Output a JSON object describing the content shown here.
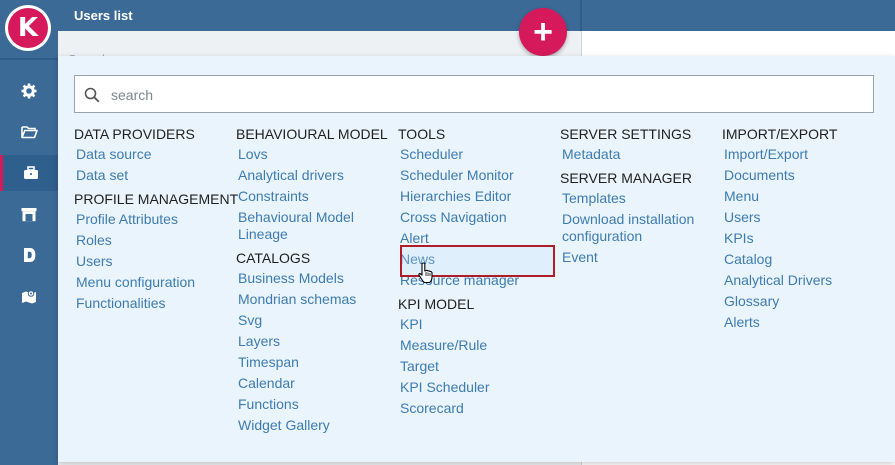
{
  "app": {
    "logo_letter": "K",
    "title": "Users list",
    "add_label": "+"
  },
  "search": {
    "placeholder": "search",
    "bg_placeholder": "Search"
  },
  "columns": [
    {
      "groups": [
        {
          "title": "DATA PROVIDERS",
          "items": [
            "Data source",
            "Data set"
          ]
        },
        {
          "title": "PROFILE MANAGEMENT",
          "items": [
            "Profile Attributes",
            "Roles",
            "Users",
            "Menu configuration",
            "Functionalities"
          ]
        }
      ]
    },
    {
      "groups": [
        {
          "title": "BEHAVIOURAL MODEL",
          "items": [
            "Lovs",
            "Analytical drivers",
            "Constraints",
            "Behavioural Model Lineage"
          ]
        },
        {
          "title": "CATALOGS",
          "items": [
            "Business Models",
            "Mondrian schemas",
            "Svg",
            "Layers",
            "Timespan",
            "Calendar",
            "Functions",
            "Widget Gallery"
          ]
        }
      ]
    },
    {
      "groups": [
        {
          "title": "TOOLS",
          "items": [
            "Scheduler",
            "Scheduler Monitor",
            "Hierarchies Editor",
            "Cross Navigation",
            "Alert",
            "News",
            "Resource manager"
          ]
        },
        {
          "title": "KPI MODEL",
          "items": [
            "KPI",
            "Measure/Rule",
            "Target",
            "KPI Scheduler",
            "Scorecard"
          ]
        }
      ]
    },
    {
      "groups": [
        {
          "title": "SERVER SETTINGS",
          "items": [
            "Metadata"
          ]
        },
        {
          "title": "SERVER MANAGER",
          "items": [
            "Templates",
            "Download installation configuration",
            "Event"
          ]
        }
      ]
    },
    {
      "groups": [
        {
          "title": "IMPORT/EXPORT",
          "items": [
            "Import/Export",
            "Documents",
            "Menu",
            "Users",
            "KPIs",
            "Catalog",
            "Analytical Drivers",
            "Glossary",
            "Alerts"
          ]
        }
      ]
    }
  ],
  "colors": {
    "sidebar": "#3b6a97",
    "accent": "#d6195a",
    "link": "#3d7bb0",
    "panel": "#eaf4fc",
    "highlight_border": "#b01c2a"
  },
  "sidebar_icons": [
    "gear-icon",
    "folder-open-icon",
    "briefcase-icon",
    "warehouse-icon",
    "document-d-icon",
    "map-icon"
  ]
}
